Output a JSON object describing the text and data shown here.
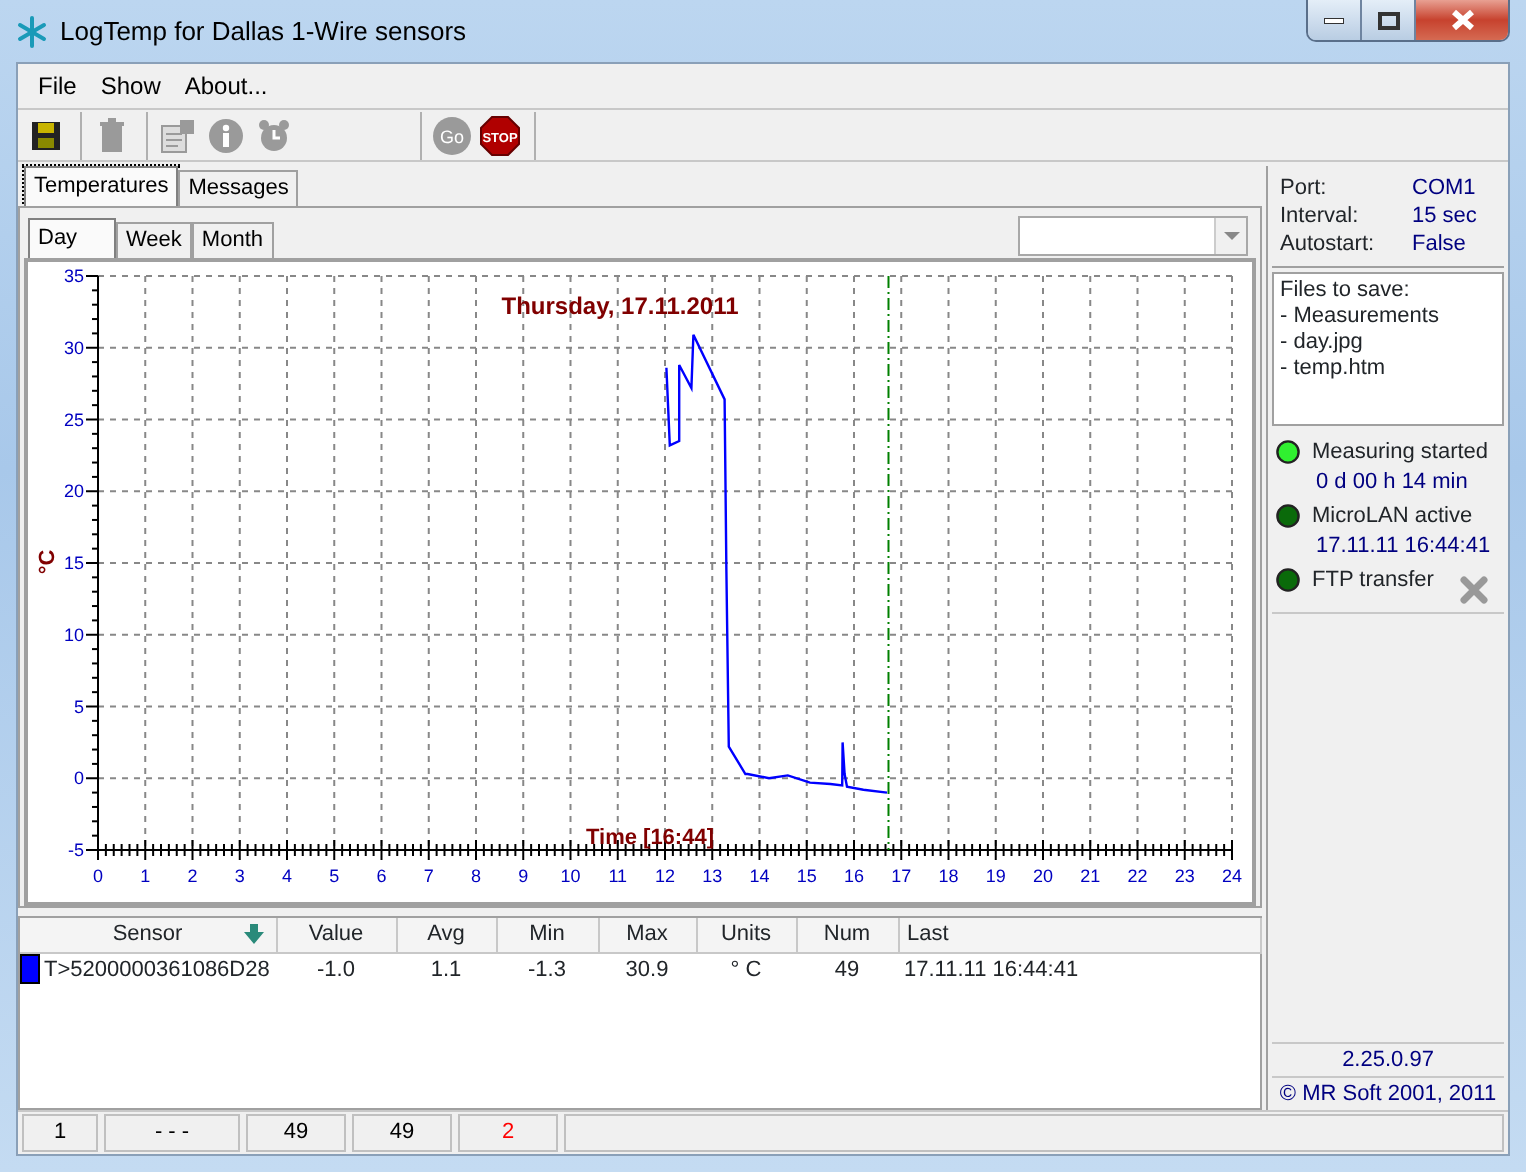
{
  "window": {
    "title": "LogTemp for Dallas 1-Wire sensors"
  },
  "menu": [
    {
      "label": "File"
    },
    {
      "label": "Show"
    },
    {
      "label": "About..."
    }
  ],
  "toolbar": [
    {
      "kind": "save",
      "disabled": false
    },
    {
      "kind": "delete",
      "disabled": true
    },
    {
      "kind": "properties",
      "disabled": true
    },
    {
      "kind": "info",
      "disabled": true
    },
    {
      "kind": "alarm",
      "disabled": true
    },
    {
      "kind": "go",
      "label": "Go",
      "disabled": true
    },
    {
      "kind": "stop",
      "label": "STOP",
      "disabled": false
    }
  ],
  "tabs": [
    {
      "label": "Temperatures",
      "selected": true
    },
    {
      "label": "Messages",
      "selected": false
    }
  ],
  "subtabs": [
    {
      "label": "Day",
      "selected": true
    },
    {
      "label": "Week",
      "selected": false
    },
    {
      "label": "Month",
      "selected": false
    }
  ],
  "chart": {
    "chart_data": {
      "type": "line",
      "title": "Thursday, 17.11.2011",
      "xlabel": "Time [16:44]",
      "ylabel": "°C",
      "x": [
        12.03,
        12.1,
        12.3,
        12.3,
        12.56,
        12.6,
        13.26,
        13.3,
        13.35,
        13.7,
        13.75,
        14.2,
        14.6,
        15.07,
        15.5,
        15.75,
        15.76,
        15.8,
        15.85,
        16.2,
        16.7
      ],
      "series": [
        {
          "color": "#0000ff",
          "values": [
            28.6,
            23.2,
            23.5,
            28.8,
            27.2,
            30.9,
            26.4,
            14.4,
            2.2,
            0.3,
            0.3,
            0.0,
            0.2,
            -0.3,
            -0.4,
            -0.5,
            2.5,
            0.3,
            -0.6,
            -0.8,
            -1.0
          ]
        }
      ],
      "xlim": [
        0,
        24
      ],
      "ylim": [
        -5,
        35
      ],
      "xticks": [
        0,
        1,
        2,
        3,
        4,
        5,
        6,
        7,
        8,
        9,
        10,
        11,
        12,
        13,
        14,
        15,
        16,
        17,
        18,
        19,
        20,
        21,
        22,
        23,
        24
      ],
      "yticks": [
        -5,
        0,
        5,
        10,
        15,
        20,
        25,
        30,
        35
      ],
      "grid": true,
      "ref_lines": [
        {
          "axis": "x",
          "value": 16.73
        }
      ]
    }
  },
  "table": {
    "columns": [
      {
        "label": "Sensor",
        "sorted": true
      },
      {
        "label": "Value",
        "sorted": false
      },
      {
        "label": "Avg",
        "sorted": false
      },
      {
        "label": "Min",
        "sorted": false
      },
      {
        "label": "Max",
        "sorted": false
      },
      {
        "label": "Units",
        "sorted": false
      },
      {
        "label": "Num",
        "sorted": false
      },
      {
        "label": "Last",
        "sorted": false
      }
    ],
    "rows": [
      {
        "color": "#0000ff",
        "cells": [
          "T>5200000361086D28",
          "-1.0",
          "1.1",
          "-1.3",
          "30.9",
          "° C",
          "49",
          "17.11.11 16:44:41"
        ]
      }
    ]
  },
  "settings": [
    {
      "label": "Port:",
      "value": "COM1"
    },
    {
      "label": "Interval:",
      "value": "15 sec"
    },
    {
      "label": "Autostart:",
      "value": "False"
    }
  ],
  "files_to_save": {
    "heading": "Files to save:",
    "items": [
      "- Measurements",
      "- day.jpg",
      "- temp.htm"
    ]
  },
  "indicators": [
    {
      "label": "Measuring started",
      "on": true,
      "detail": "0 d 00 h 14 min"
    },
    {
      "label": "MicroLAN active",
      "on": false,
      "detail": "17.11.11 16:44:41"
    },
    {
      "label": "FTP transfer",
      "on": false
    }
  ],
  "version": "2.25.0.97",
  "copyright": "© MR Soft 2001, 2011",
  "status_bar": [
    {
      "text": "1",
      "alert": false
    },
    {
      "text": "- - -",
      "alert": false
    },
    {
      "text": "49",
      "alert": false
    },
    {
      "text": "49",
      "alert": false
    },
    {
      "text": "2",
      "alert": true
    }
  ]
}
